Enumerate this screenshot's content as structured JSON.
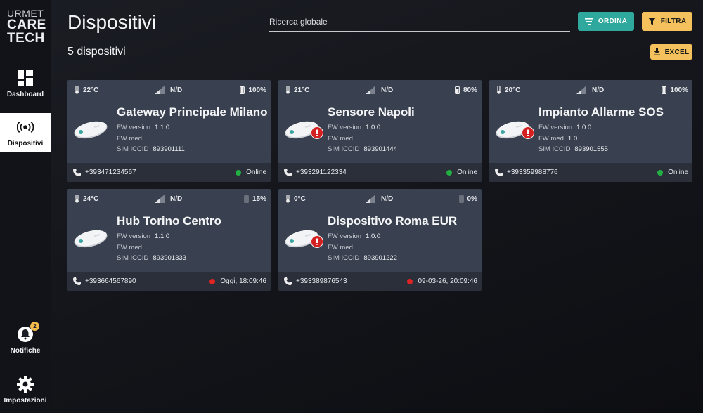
{
  "brand": {
    "line1": "URMET",
    "line2": "CARE",
    "line3": "TECH"
  },
  "sidebar": {
    "dashboard": "Dashboard",
    "dispositivi": "Dispositivi",
    "notifiche": "Notifiche",
    "notifiche_badge": "2",
    "impostazioni": "Impostazioni"
  },
  "header": {
    "title": "Dispositivi",
    "count": "5 dispositivi",
    "search_placeholder": "Ricerca globale",
    "ordina": "ORDINA",
    "filtra": "FILTRA",
    "excel": "EXCEL"
  },
  "labels": {
    "fw_version": "FW version",
    "fw_med": "FW med",
    "sim_iccid": "SIM ICCID"
  },
  "devices": [
    {
      "temp": "22°C",
      "signal": "N/D",
      "battery": "100%",
      "battery_level": 1.0,
      "name": "Gateway Principale Milano",
      "fw_version": "1.1.0",
      "fw_med": "",
      "sim_iccid": "893901111",
      "phone": "+393471234567",
      "status": "Online",
      "status_color": "#23b043",
      "alert": false
    },
    {
      "temp": "21°C",
      "signal": "N/D",
      "battery": "80%",
      "battery_level": 0.8,
      "name": "Sensore Napoli",
      "fw_version": "1.0.0",
      "fw_med": "",
      "sim_iccid": "893901444",
      "phone": "+393291122334",
      "status": "Online",
      "status_color": "#23b043",
      "alert": true
    },
    {
      "temp": "20°C",
      "signal": "N/D",
      "battery": "100%",
      "battery_level": 1.0,
      "name": "Impianto Allarme SOS",
      "fw_version": "1.0.0",
      "fw_med": "1.0",
      "sim_iccid": "893901555",
      "phone": "+393359988776",
      "status": "Online",
      "status_color": "#23b043",
      "alert": true
    },
    {
      "temp": "24°C",
      "signal": "N/D",
      "battery": "15%",
      "battery_level": 0.15,
      "name": "Hub Torino Centro",
      "fw_version": "1.1.0",
      "fw_med": "",
      "sim_iccid": "893901333",
      "phone": "+393664567890",
      "status": "Oggi, 18:09:46",
      "status_color": "#e02424",
      "alert": false
    },
    {
      "temp": "0°C",
      "signal": "N/D",
      "battery": "0%",
      "battery_level": 0.0,
      "name": "Dispositivo Roma EUR",
      "fw_version": "1.0.0",
      "fw_med": "",
      "sim_iccid": "893901222",
      "phone": "+393389876543",
      "status": "09-03-26, 20:09:46",
      "status_color": "#e02424",
      "alert": true
    }
  ]
}
